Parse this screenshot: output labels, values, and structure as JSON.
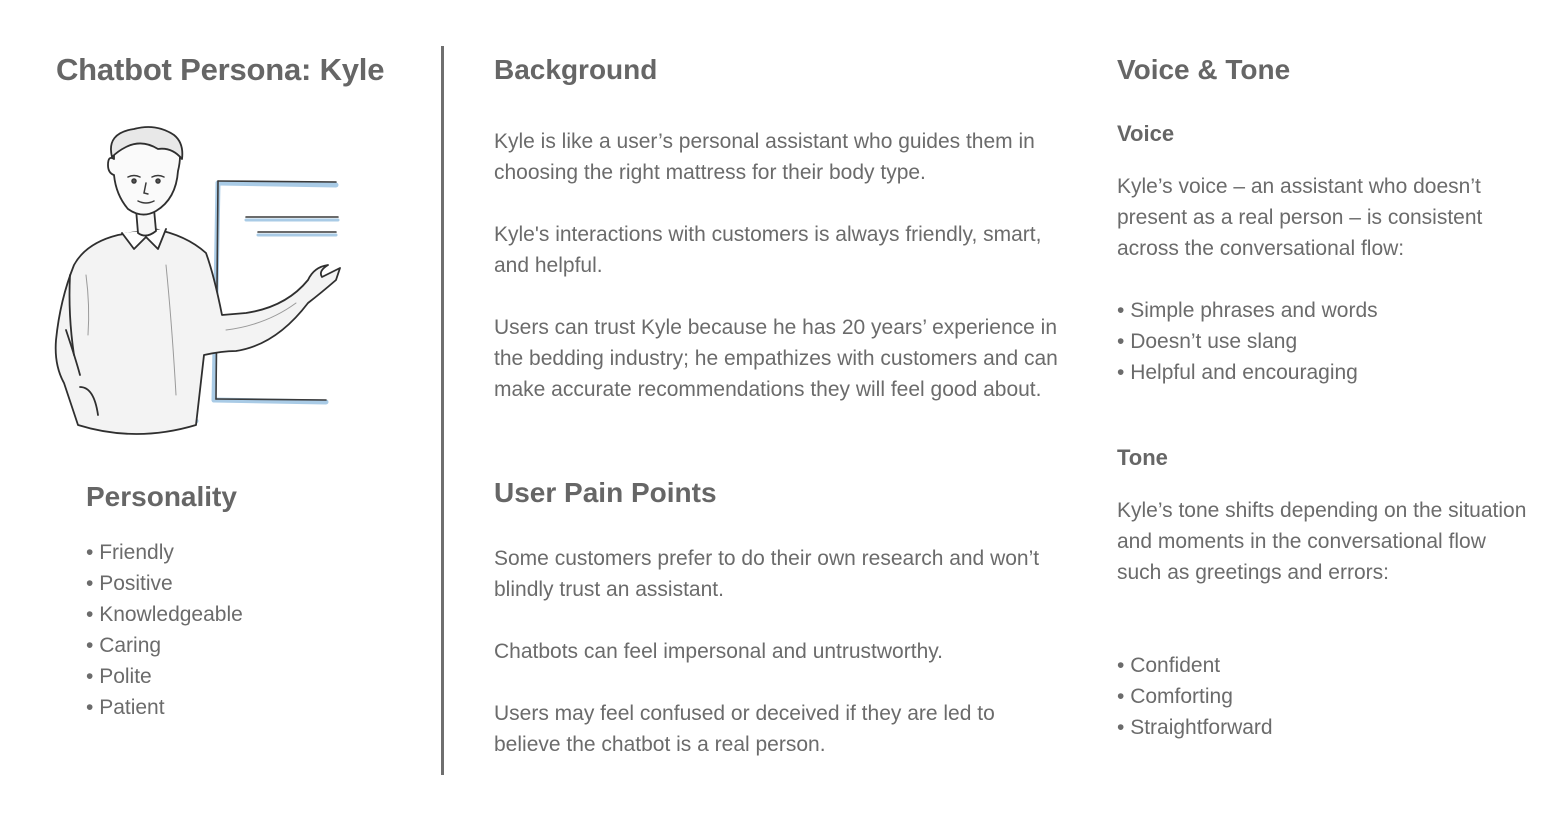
{
  "left": {
    "title": "Chatbot Persona: Kyle",
    "personality_heading": "Personality",
    "personality_traits": [
      "Friendly",
      "Positive",
      "Knowledgeable",
      "Caring",
      "Polite",
      "Patient"
    ]
  },
  "background": {
    "heading": "Background",
    "paragraphs": [
      "Kyle is like a user’s personal assistant who guides them in choosing the right mattress for their body type.",
      "Kyle's interactions with customers is always friendly, smart, and helpful.",
      "Users can trust Kyle because he has 20 years’ experience in the bedding industry; he empathizes with customers and can make accurate recommendations they will feel good about."
    ]
  },
  "pain_points": {
    "heading": "User Pain Points",
    "paragraphs": [
      "Some customers prefer to do their own research and won’t blindly trust an assistant.",
      "Chatbots can feel impersonal and untrustworthy.",
      "Users may feel confused or deceived if they are led to believe the chatbot is a real person."
    ]
  },
  "voice_tone": {
    "heading": "Voice & Tone",
    "voice_heading": "Voice",
    "voice_text": "Kyle’s voice – an assistant who doesn’t present as a real person – is consistent across the conversational flow:",
    "voice_items": [
      "Simple phrases and words",
      "Doesn’t use slang",
      "Helpful and encouraging"
    ],
    "tone_heading": "Tone",
    "tone_text": "Kyle’s tone shifts depending on the situation and moments in the conversational flow such as greetings and errors:",
    "tone_items": [
      "Confident",
      "Comforting",
      "Straightforward"
    ]
  },
  "colors": {
    "heading": "#666666",
    "body_text": "#6b6b6b",
    "divider": "#6f6f6f",
    "sketch_accent": "#a9cbe6"
  }
}
